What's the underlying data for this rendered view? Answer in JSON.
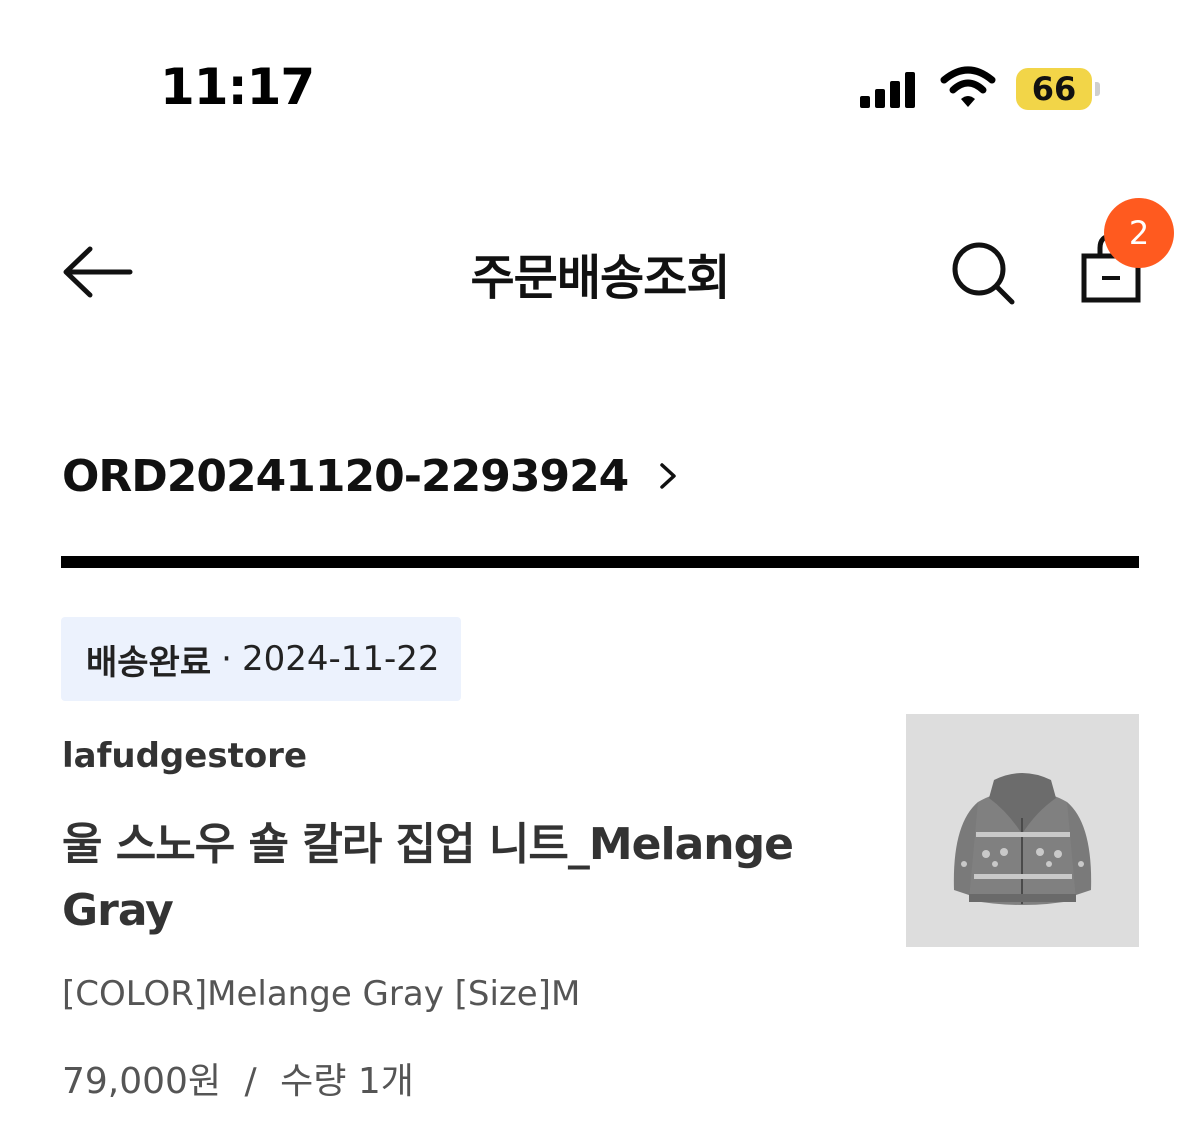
{
  "status_bar": {
    "time": "11:17",
    "battery_level": "66",
    "icons": [
      "signal-icon",
      "wifi-icon",
      "battery-icon"
    ]
  },
  "header": {
    "title": "주문배송조회",
    "cart_count": "2",
    "icons": [
      "back-arrow-icon",
      "search-icon",
      "shopping-bag-icon"
    ]
  },
  "order": {
    "number": "ORD20241120-2293924"
  },
  "status": {
    "label": "배송완료",
    "separator": "·",
    "date": "2024-11-22"
  },
  "product": {
    "store": "lafudgestore",
    "name": "울 스노우 숄 칼라 집업 니트_Melange Gray",
    "option": "[COLOR]Melange Gray [Size]M",
    "price": "79,000원",
    "price_separator": "/",
    "quantity": "수량 1개"
  },
  "colors": {
    "badge": "#ff5a1f",
    "status_chip_bg": "#ecf2fd",
    "battery": "#f2d548",
    "divider": "#000000"
  }
}
